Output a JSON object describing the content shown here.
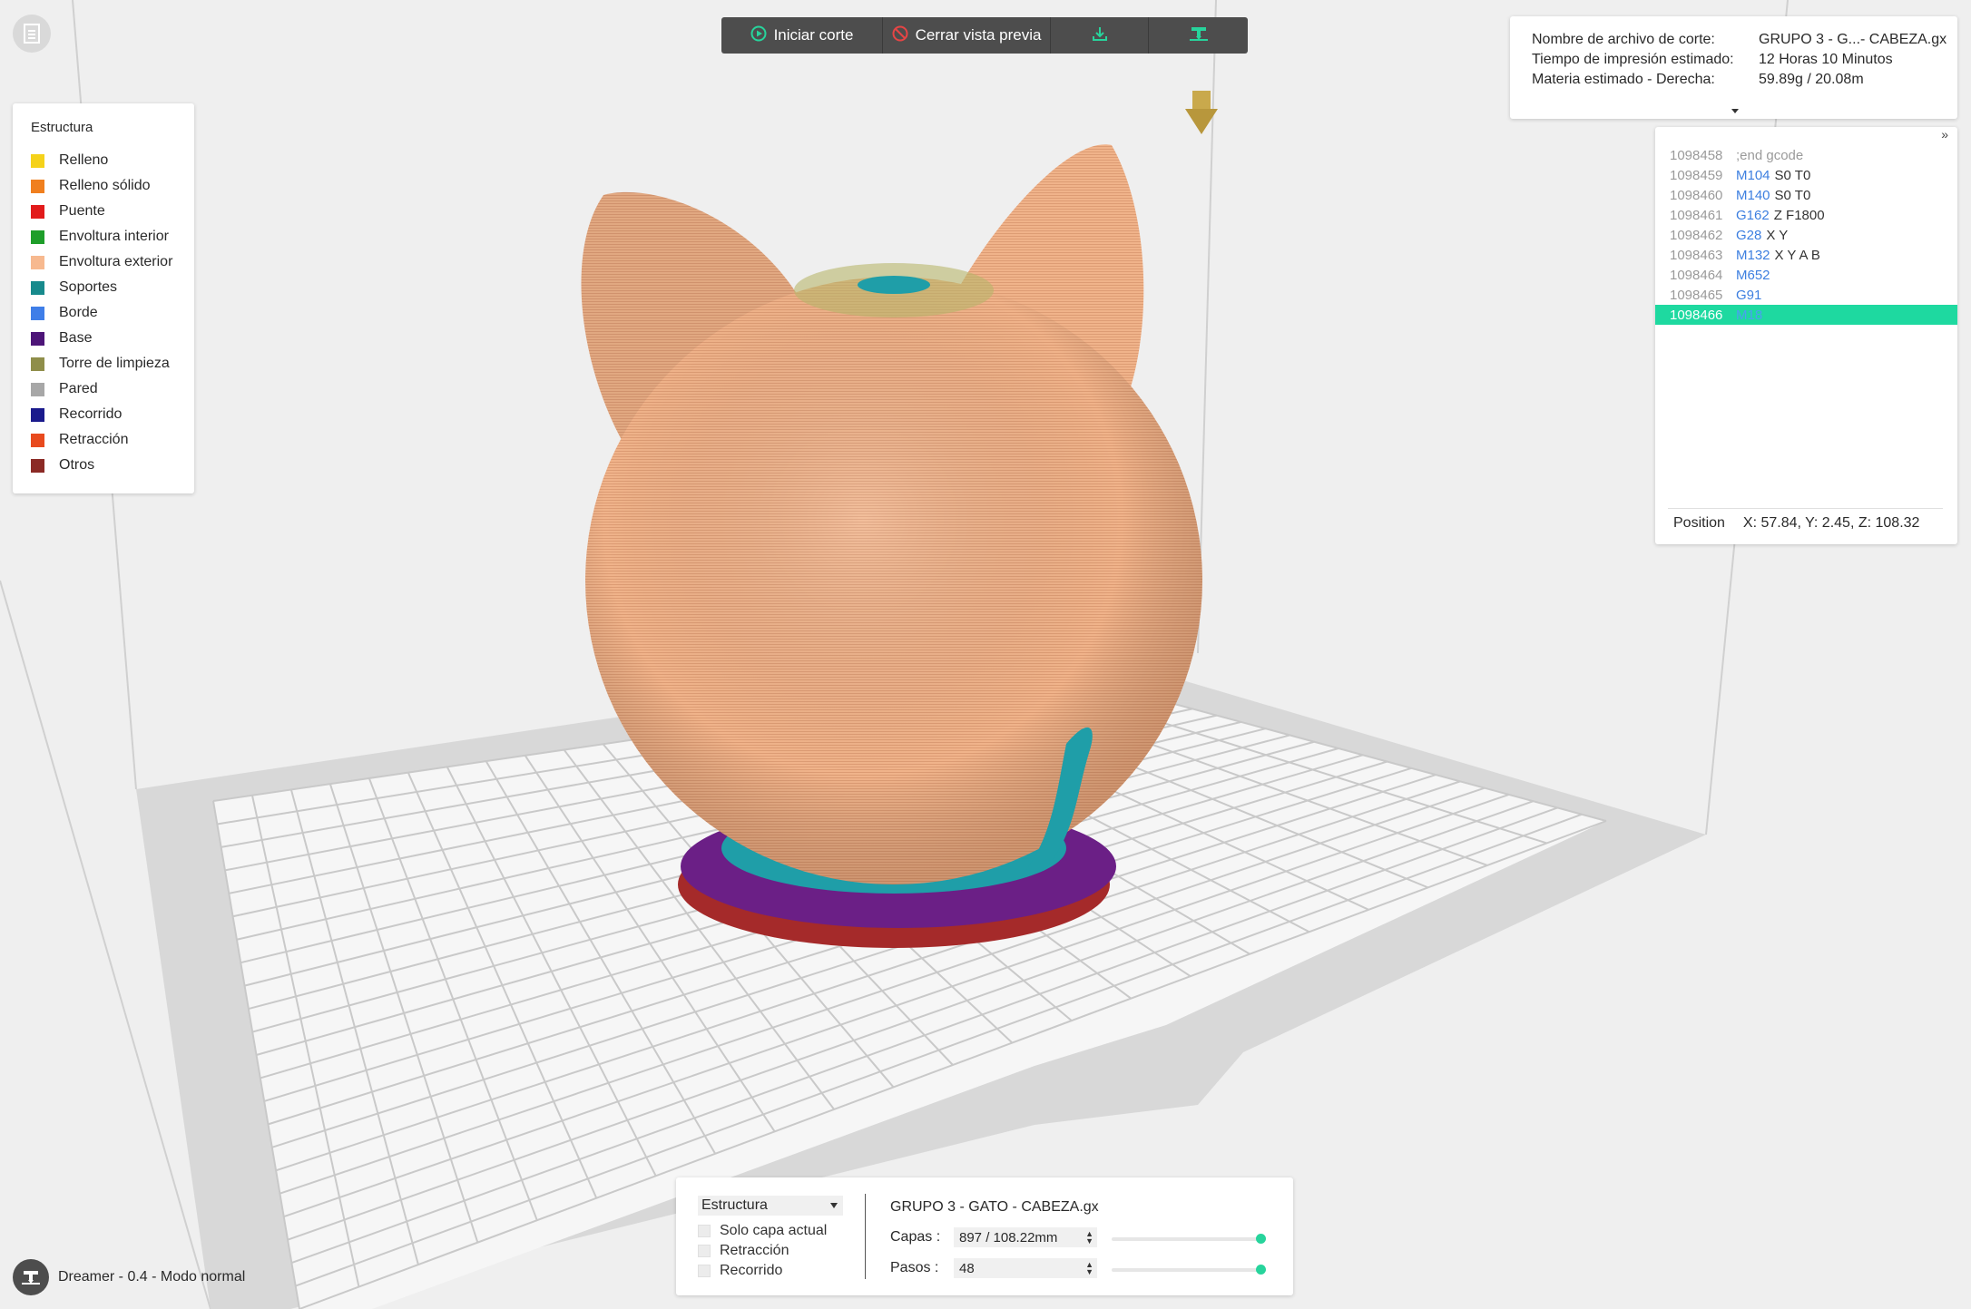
{
  "toolbar": {
    "start_label": "Iniciar corte",
    "close_preview_label": "Cerrar vista previa",
    "colors": {
      "background": "#4d4d4d",
      "icon_accent": "#27d49c",
      "stop_icon": "#e64545"
    }
  },
  "legend": {
    "title": "Estructura",
    "items": [
      {
        "label": "Relleno",
        "color": "#f5d21a"
      },
      {
        "label": "Relleno sólido",
        "color": "#f07f1e"
      },
      {
        "label": "Puente",
        "color": "#e21b1b"
      },
      {
        "label": "Envoltura interior",
        "color": "#1e9e2a"
      },
      {
        "label": "Envoltura exterior",
        "color": "#f7b98f"
      },
      {
        "label": "Soportes",
        "color": "#178a8c"
      },
      {
        "label": "Borde",
        "color": "#3f7ee8"
      },
      {
        "label": "Base",
        "color": "#4d1578"
      },
      {
        "label": "Torre de limpieza",
        "color": "#8f8e4a"
      },
      {
        "label": "Pared",
        "color": "#a7a7a7"
      },
      {
        "label": "Recorrido",
        "color": "#1a1a8c"
      },
      {
        "label": "Retracción",
        "color": "#e84a1e"
      },
      {
        "label": "Otros",
        "color": "#8b2a25"
      }
    ]
  },
  "info": {
    "rows": [
      {
        "key": "Nombre de archivo de corte:",
        "value": "GRUPO 3 - G...- CABEZA.gx"
      },
      {
        "key": "Tiempo de impresión estimado:",
        "value": "12 Horas 10 Minutos"
      },
      {
        "key": "Materia estimado - Derecha:",
        "value": "59.89g / 20.08m"
      }
    ]
  },
  "gcode": {
    "expand_label": "»",
    "lines": [
      {
        "num": "1098458",
        "cmd": "",
        "args": "",
        "comment": ";end gcode"
      },
      {
        "num": "1098459",
        "cmd": "M104",
        "args": "S0 T0",
        "comment": ""
      },
      {
        "num": "1098460",
        "cmd": "M140",
        "args": "S0 T0",
        "comment": ""
      },
      {
        "num": "1098461",
        "cmd": "G162",
        "args": "Z F1800",
        "comment": ""
      },
      {
        "num": "1098462",
        "cmd": "G28",
        "args": "X Y",
        "comment": ""
      },
      {
        "num": "1098463",
        "cmd": "M132",
        "args": "X Y A B",
        "comment": ""
      },
      {
        "num": "1098464",
        "cmd": "M652",
        "args": "",
        "comment": ""
      },
      {
        "num": "1098465",
        "cmd": "G91",
        "args": "",
        "comment": ""
      },
      {
        "num": "1098466",
        "cmd": "M18",
        "args": "",
        "comment": "",
        "active": true
      }
    ],
    "position_label": "Position",
    "position_value": "X: 57.84, Y: 2.45, Z: 108.32"
  },
  "bottom": {
    "structure_select": "Estructura",
    "checkboxes": [
      "Solo capa actual",
      "Retracción",
      "Recorrido"
    ],
    "file_name": "GRUPO 3 - GATO - CABEZA.gx",
    "layers_label": "Capas :",
    "layers_value": "897 / 108.22mm",
    "layers_fraction": 1.0,
    "steps_label": "Pasos :",
    "steps_value": "48",
    "steps_fraction": 1.0
  },
  "printer": {
    "label": "Dreamer - 0.4 - Modo normal"
  },
  "scene": {
    "colors": {
      "background": "#efefef",
      "bed_frame": "#d6d6d6",
      "grid_line": "#c8c8c8",
      "outer_shell": "#f0b38a",
      "base": "#6b1f86",
      "support": "#1f9ea8",
      "other": "#a52a2a",
      "nozzle": "#c9a94c"
    }
  }
}
